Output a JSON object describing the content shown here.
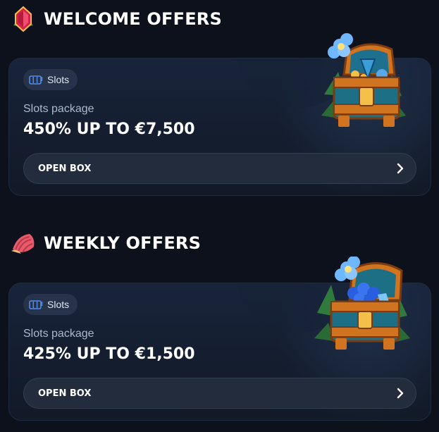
{
  "sections": [
    {
      "title": "WELCOME OFFERS",
      "icon": "gem-icon",
      "card": {
        "tag": "Slots",
        "tag_icon": "slot-machine-icon",
        "package_label": "Slots package",
        "offer": "450% UP TO €7,500",
        "button_label": "OPEN BOX",
        "button_icon": "chevron-right-icon",
        "illustration": "treasure-chest-icon"
      }
    },
    {
      "title": "WEEKLY OFFERS",
      "icon": "shell-icon",
      "card": {
        "tag": "Slots",
        "tag_icon": "slot-machine-icon",
        "package_label": "Slots package",
        "offer": "425% UP TO €1,500",
        "button_label": "OPEN BOX",
        "button_icon": "chevron-right-icon",
        "illustration": "treasure-chest-icon"
      }
    }
  ],
  "colors": {
    "background": "#0d111c",
    "card": "#18243a",
    "button": "#232c3d",
    "tag": "#26334a",
    "muted_text": "#aab9cf"
  }
}
